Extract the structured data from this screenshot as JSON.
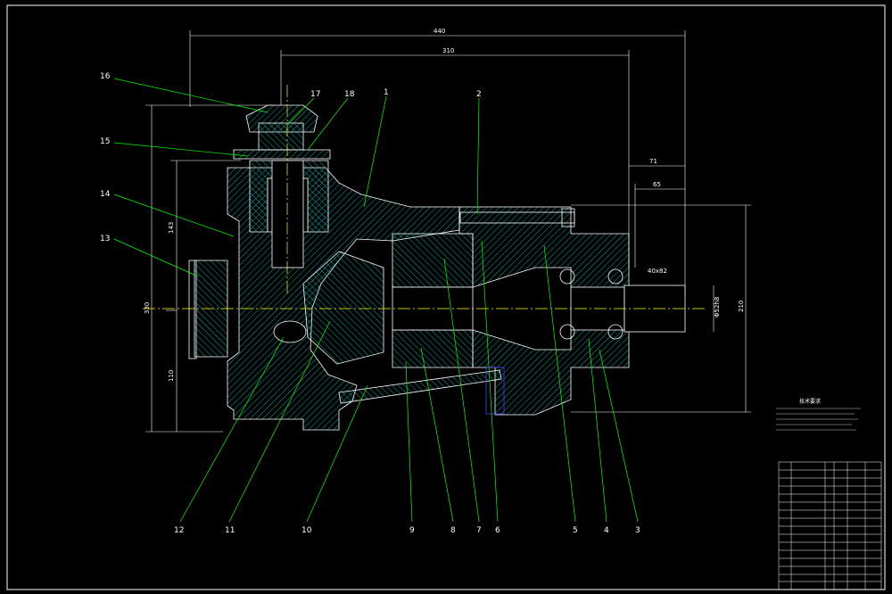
{
  "colors": {
    "background": "#000000",
    "frame": "#ffffff",
    "outline": "#ffffff",
    "leader": "#00ff00",
    "hatch": "#00cccc",
    "section_line": "#ffff00",
    "hidden": "#4444ff"
  },
  "dimensions": {
    "overall_length": "440",
    "length_310": "310",
    "height_143": "143",
    "height_330": "330",
    "height_110": "110",
    "right_71": "71",
    "right_65": "65",
    "height_210": "210",
    "shaft_diameter": "40x82",
    "right_diameter": "Φ52h8"
  },
  "part_labels": {
    "p1": "1",
    "p2": "2",
    "p3": "3",
    "p4": "4",
    "p5": "5",
    "p6": "6",
    "p7": "7",
    "p8": "8",
    "p9": "9",
    "p10": "10",
    "p11": "11",
    "p12": "12",
    "p13": "13",
    "p14": "14",
    "p15": "15",
    "p16": "16",
    "p17": "17",
    "p18": "18"
  },
  "notes": {
    "title": "技术要求"
  },
  "icons": {
    "crosshair": "centerline-icon"
  }
}
